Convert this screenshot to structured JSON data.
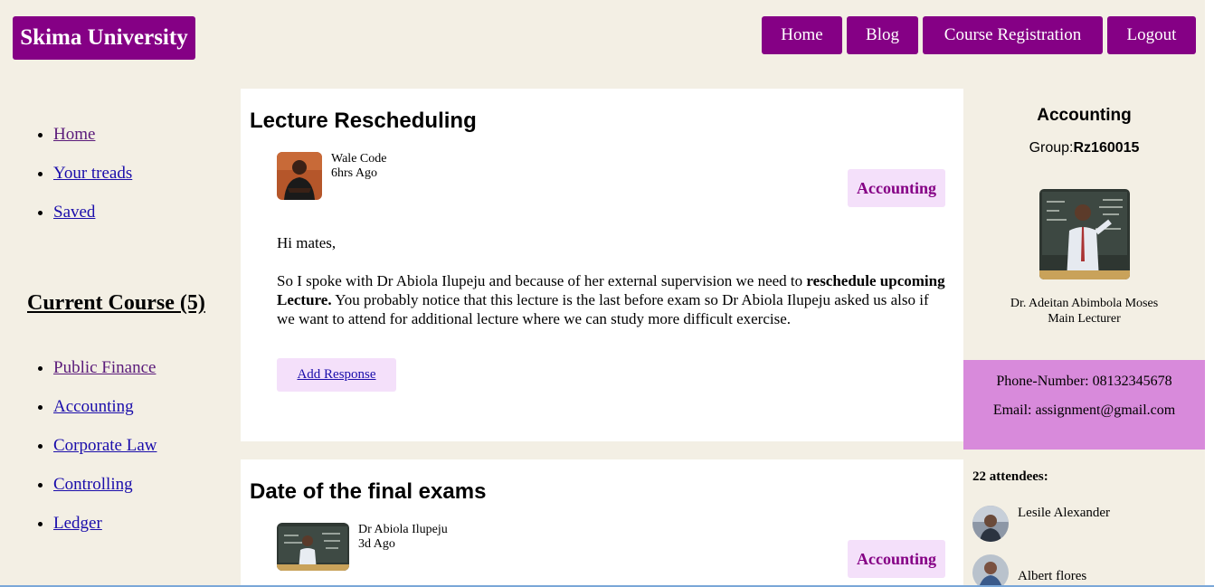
{
  "brand": "Skima University",
  "nav": {
    "home": "Home",
    "blog": "Blog",
    "course_registration": "Course Registration",
    "logout": "Logout"
  },
  "sidebar": {
    "links": [
      "Home",
      "Your treads",
      "Saved"
    ],
    "current_course_title": "Current Course (5)",
    "courses": [
      "Public Finance",
      "Accounting",
      "Corporate Law",
      "Controlling",
      "Ledger"
    ]
  },
  "posts": [
    {
      "title": "Lecture Rescheduling",
      "author": "Wale Code",
      "time": "6hrs Ago",
      "tag": "Accounting",
      "greeting": "Hi mates,",
      "body_pre": "So I spoke with Dr Abiola Ilupeju and because of her external supervision we need to ",
      "body_bold": "reschedule upcoming Lecture.",
      "body_post": " You probably notice that this lecture is the last before exam so Dr Abiola Ilupeju asked us also if we want to attend for additional lecture where we can study more difficult exercise.",
      "response_label": "Add Response"
    },
    {
      "title": "Date of the final exams",
      "author": "Dr Abiola Ilupeju",
      "time": "3d Ago",
      "tag": "Accounting"
    }
  ],
  "right": {
    "course": "Accounting",
    "group_label": "Group:",
    "group_value": "Rz160015",
    "lecturer_name": "Dr. Adeitan Abimbola Moses",
    "lecturer_role": "Main Lecturer",
    "phone": "Phone-Number: 08132345678",
    "email": "Email: assignment@gmail.com",
    "attendees_title": "22 attendees:",
    "attendees": [
      "Lesile Alexander",
      "Albert flores"
    ]
  }
}
